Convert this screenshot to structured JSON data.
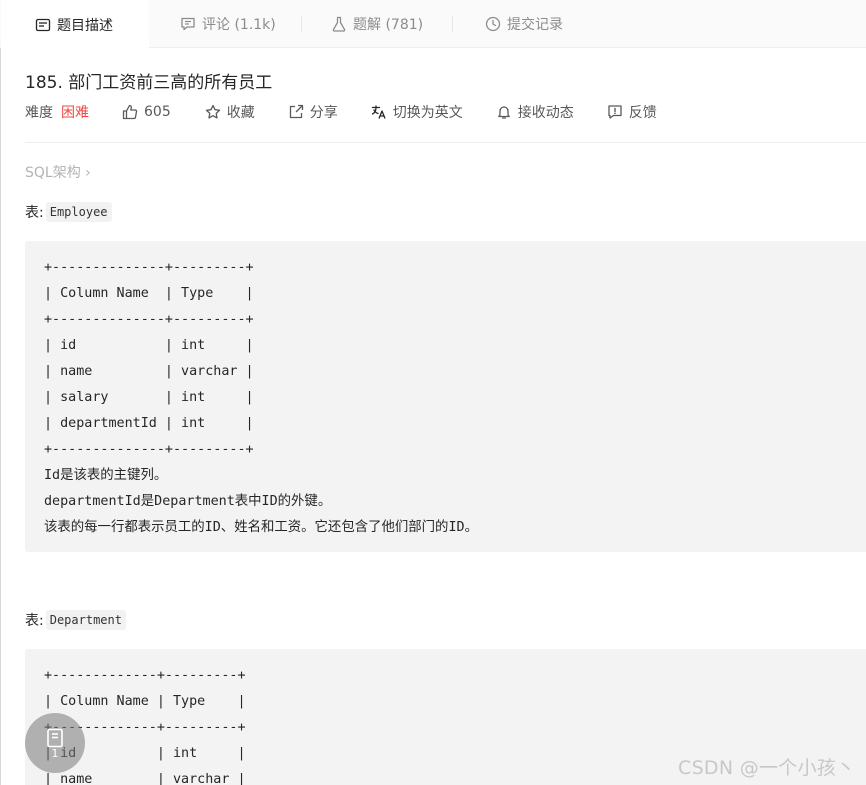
{
  "tabs": [
    {
      "label": "题目描述",
      "icon": "description-icon"
    },
    {
      "label": "评论 (1.1k)",
      "icon": "comment-icon"
    },
    {
      "label": "题解 (781)",
      "icon": "flask-icon"
    },
    {
      "label": "提交记录",
      "icon": "clock-icon"
    }
  ],
  "problem": {
    "title": "185. 部门工资前三高的所有员工",
    "difficulty_label": "难度",
    "difficulty_value": "困难",
    "likes": "605",
    "favorite_label": "收藏",
    "share_label": "分享",
    "switch_lang_label": "切换为英文",
    "subscribe_label": "接收动态",
    "feedback_label": "反馈"
  },
  "breadcrumb": "SQL架构 ›",
  "employee": {
    "label_prefix": "表: ",
    "table_name": "Employee",
    "lines": [
      "+--------------+---------+",
      "| Column Name  | Type    |",
      "+--------------+---------+",
      "| id           | int     |",
      "| name         | varchar |",
      "| salary       | int     |",
      "| departmentId | int     |",
      "+--------------+---------+",
      "Id是该表的主键列。",
      "departmentId是Department表中ID的外键。",
      "该表的每一行都表示员工的ID、姓名和工资。它还包含了他们部门的ID。"
    ]
  },
  "department": {
    "label_prefix": "表: ",
    "table_name": "Department",
    "lines": [
      "+-------------+---------+",
      "| Column Name | Type    |",
      "+-------------+---------+",
      "| id          | int     |",
      "| name        | varchar |"
    ]
  },
  "fab": {
    "count": "1"
  },
  "watermark": "CSDN @一个小孩丶",
  "colors": {
    "difficulty_hard": "#ef4743",
    "code_bg": "#f3f3f4",
    "muted": "#8c8c8c"
  }
}
